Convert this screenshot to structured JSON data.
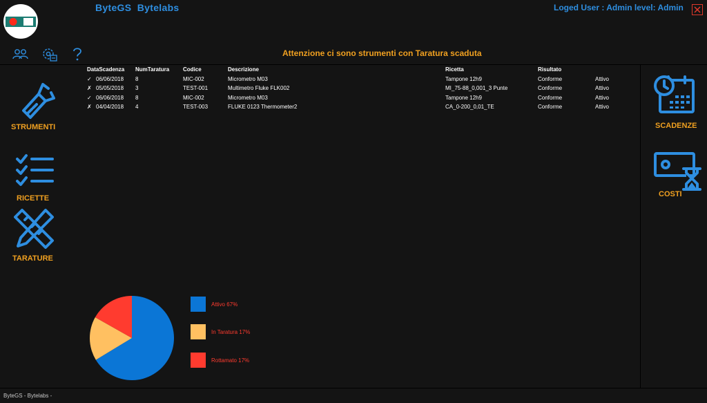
{
  "app": {
    "title": "ByteGS  Bytelabs",
    "user_info": "Loged User : Admin  level: Admin",
    "footer": "ByteGS - Bytelabs -"
  },
  "toolbar": {
    "icons": [
      "users-icon",
      "settings-icon",
      "help-icon"
    ]
  },
  "alert": {
    "text": "Attenzione ci sono strumenti con Taratura scaduta"
  },
  "left_nav": {
    "strumenti": "STRUMENTI",
    "ricette": "RICETTE",
    "tarature": "TARATURE"
  },
  "right_nav": {
    "scadenze": "SCADENZE",
    "costi": "COSTI"
  },
  "table": {
    "headers": [
      "DataScadenza",
      "NumTaratura",
      "Codice",
      "Descrizione",
      "Ricetta",
      "Risultato"
    ],
    "rows": [
      {
        "mark": "✓",
        "date": "06/06/2018",
        "num": "8",
        "code": "MIC-002",
        "desc": "Micrometro M03",
        "recipe": "Tampone 12h9",
        "result": "Conforme",
        "status": "Attivo"
      },
      {
        "mark": "✗",
        "date": "05/05/2018",
        "num": "3",
        "code": "TEST-001",
        "desc": "Multimetro Fluke FLK002",
        "recipe": "MI_75-88_0,001_3 Punte",
        "result": "Conforme",
        "status": "Attivo"
      },
      {
        "mark": "✓",
        "date": "06/06/2018",
        "num": "8",
        "code": "MIC-002",
        "desc": "Micrometro M03",
        "recipe": "Tampone 12h9",
        "result": "Conforme",
        "status": "Attivo"
      },
      {
        "mark": "✗",
        "date": "04/04/2018",
        "num": "4",
        "code": "TEST-003",
        "desc": "FLUKE 0123 Thermometer2",
        "recipe": "CA_0-200_0,01_TE",
        "result": "Conforme",
        "status": "Attivo"
      }
    ]
  },
  "colors": {
    "accent_blue": "#2e8ee0",
    "accent_orange": "#f0a020",
    "pie_blue": "#0b76d6",
    "pie_yellow": "#ffc061",
    "pie_red": "#ff3b2f"
  },
  "chart_data": {
    "type": "pie",
    "slices": [
      {
        "label": "Attivo 67%",
        "value": 67,
        "color": "#0b76d6"
      },
      {
        "label": "In Taratura 17%",
        "value": 17,
        "color": "#ffc061"
      },
      {
        "label": "Rottamato 17%",
        "value": 17,
        "color": "#ff3b2f"
      }
    ]
  }
}
